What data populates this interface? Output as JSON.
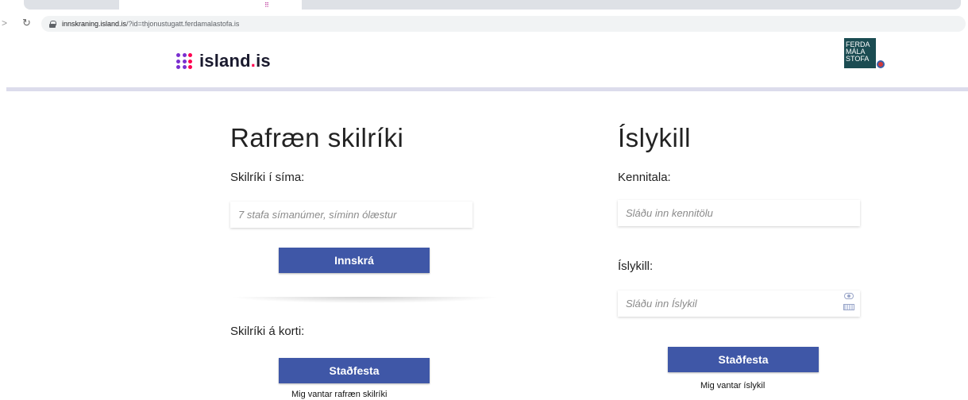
{
  "browser": {
    "url_host": "innskraning.island.is",
    "url_rest": "/?id=thjonustugatt.ferdamalastofa.is",
    "tab_dots": "⠿"
  },
  "header": {
    "logo_main": "island",
    "logo_dot": ".",
    "logo_tld": "is",
    "partner_logo_lines": [
      "FERDA",
      "MÁLA",
      "STOFA"
    ]
  },
  "left": {
    "title": "Rafræn skilríki",
    "phone_label": "Skilríki í síma:",
    "phone_placeholder": "7 stafa símanúmer, síminn ólæstur",
    "login_button": "Innskrá",
    "card_label": "Skilríki á korti:",
    "confirm_button": "Staðfesta",
    "missing_link": "Mig vantar rafræn skilríki"
  },
  "right": {
    "title": "Íslykill",
    "kennitala_label": "Kennitala:",
    "kennitala_placeholder": "Sláðu inn kennitölu",
    "islykill_label": "Íslykill:",
    "islykill_placeholder": "Sláðu inn Íslykil",
    "confirm_button": "Staðfesta",
    "missing_link": "Mig vantar íslykil"
  },
  "colors": {
    "button": "#3f57a7",
    "brand_purple": "#7a2fcf",
    "brand_pink": "#ff0050",
    "partner_bg": "#1b4c52"
  }
}
